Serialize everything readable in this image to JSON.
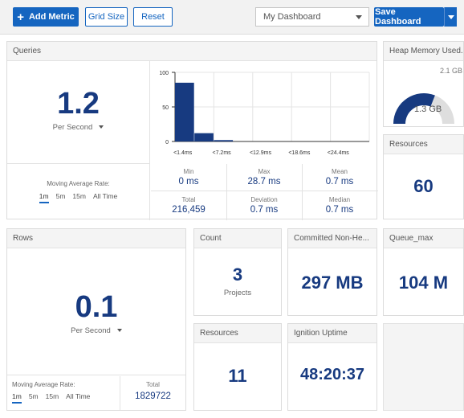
{
  "toolbar": {
    "add_metric": "Add Metric",
    "grid_size": "Grid Size",
    "reset": "Reset",
    "dashboard_select": "My Dashboard",
    "save_dashboard": "Save Dashboard"
  },
  "queries": {
    "title": "Queries",
    "value": "1.2",
    "unit": "Per Second",
    "moving_label": "Moving Average Rate:",
    "rates": [
      "1m",
      "5m",
      "15m",
      "All Time"
    ],
    "stats": {
      "min": {
        "label": "Min",
        "value": "0 ms"
      },
      "max": {
        "label": "Max",
        "value": "28.7 ms"
      },
      "mean": {
        "label": "Mean",
        "value": "0.7 ms"
      },
      "total": {
        "label": "Total",
        "value": "216,459"
      },
      "deviation": {
        "label": "Deviation",
        "value": "0.7 ms"
      },
      "median": {
        "label": "Median",
        "value": "0.7 ms"
      }
    }
  },
  "chart_data": {
    "type": "bar",
    "categories": [
      "<1.4ms",
      "",
      "<7.2ms",
      "",
      "<12.9ms",
      "",
      "<18.6ms",
      "",
      "<24.4ms",
      ""
    ],
    "values": [
      85,
      12,
      2,
      0,
      0,
      0,
      0,
      0,
      0,
      0
    ],
    "ylim": [
      0,
      100
    ],
    "yticks": [
      "0",
      "50",
      "100"
    ],
    "xlabel": "",
    "ylabel": "",
    "title": ""
  },
  "heap": {
    "title": "Heap Memory Used...",
    "max": "2.1 GB",
    "value": "1.3 GB",
    "fraction": 0.62
  },
  "resources_top": {
    "title": "Resources",
    "value": "60"
  },
  "rows": {
    "title": "Rows",
    "value": "0.1",
    "unit": "Per Second",
    "moving_label": "Moving Average Rate:",
    "rates": [
      "1m",
      "5m",
      "15m",
      "All Time"
    ],
    "total_label": "Total",
    "total_value": "1829722"
  },
  "count": {
    "title": "Count",
    "value": "3",
    "sub": "Projects"
  },
  "committed": {
    "title": "Committed Non-He...",
    "value": "297 MB"
  },
  "queue": {
    "title": "Queue_max",
    "value": "104 M"
  },
  "resources_bottom": {
    "title": "Resources",
    "value": "11"
  },
  "uptime": {
    "title": "Ignition Uptime",
    "value": "48:20:37"
  },
  "colors": {
    "accent": "#1565c0",
    "value_text": "#173a80"
  }
}
